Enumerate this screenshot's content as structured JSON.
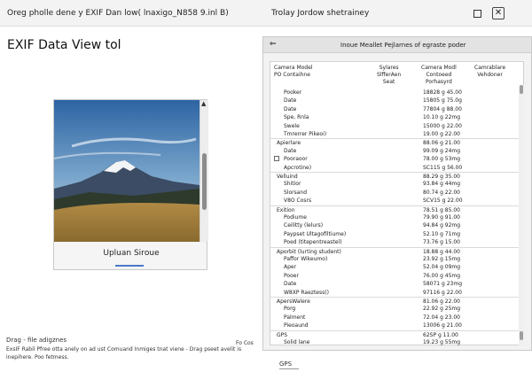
{
  "window": {
    "title": "Oreg pholle dene y EXIF Dan low( lnaxigo_N858 9.inl B)",
    "center_label": "Trolay Jordow shetrainey"
  },
  "app": {
    "title": "EXIF Data View tol"
  },
  "image_card": {
    "caption": "Upluan Sirоue"
  },
  "status": {
    "line1": "Drag - file adigznes",
    "line2": "ExsIF Rabil Pfree otta anely on ad ust Comuand Inmiges tnat viene - Drag pseet avelit is inepihere. Poo fetmess.",
    "right_label": "Fo Cos"
  },
  "panel": {
    "title": "Inoue Meallet Pejlarnes of egraste poder",
    "icon": "drag-handle-icon",
    "headers": [
      "Camera Model\nPO Contaihne",
      "Sylares\nSlfferAen\nSeat",
      "Camera Modl\nContoeed\nPorhasyrd",
      "Camrablare\nVehdoner"
    ],
    "rows": [
      {
        "label": "Pooker",
        "value": "18828 g 45.00"
      },
      {
        "label": "Date",
        "value": "15805 g 75.0g"
      },
      {
        "label": "Date",
        "value": "77804 g 88.00"
      },
      {
        "label": "Spe, Rnla",
        "value": "10.10 g 22mg"
      },
      {
        "label": "Swele",
        "value": "15000 g 22.00"
      },
      {
        "label": "Tmrerrer Pikeoi)",
        "value": "19.00 g 22.00"
      },
      {
        "label": "Apierlare",
        "value": "88.06 g 21.00",
        "section": true
      },
      {
        "label": "Date",
        "value": "99.09 g 24mg"
      },
      {
        "label": "Pooraoor",
        "value": "78.00 g 53mg",
        "check": true
      },
      {
        "label": "Apcrotine)",
        "value": "SC115 g 56.00"
      },
      {
        "label": "Velluind",
        "value": "88.29 g 35.00",
        "section": true
      },
      {
        "label": "Shitior",
        "value": "93.84 g 44mg"
      },
      {
        "label": "Slorsand",
        "value": "80.74 g 22.00"
      },
      {
        "label": "V8O Cosrs",
        "value": "SCV15 g 22.00"
      },
      {
        "label": "Exition",
        "value": "78.51 g 85.00",
        "section": true
      },
      {
        "label": "Podiume",
        "value": "79.90 g 91.00"
      },
      {
        "label": "Ceilitty (lelurs)",
        "value": "94.84 g 92mg"
      },
      {
        "label": "Paypset Ultagofiltiume)",
        "value": "52.10 g 71mg"
      },
      {
        "label": "Poed (titepentreastel)",
        "value": "73.76 g 15.00"
      },
      {
        "label": "Aporbit (lurting student)",
        "value": "18.88 g 44.00",
        "section": true
      },
      {
        "label": "Paffor Wikeumo)",
        "value": "23.92 g 15mg"
      },
      {
        "label": "Aper",
        "value": "52.04 g 09mg"
      },
      {
        "label": "Pooer",
        "value": "76.00 g 45mg"
      },
      {
        "label": "Date",
        "value": "58071 g 23mg"
      },
      {
        "label": "W8XP Raeztess()",
        "value": "97116 g 22.00"
      },
      {
        "label": "ApersWalere",
        "value": "81.06 g 22.00",
        "section": true
      },
      {
        "label": "Porg",
        "value": "22.92 g 25mg"
      },
      {
        "label": "Palment",
        "value": "72.04 g 23.00"
      },
      {
        "label": "Pieoaund",
        "value": "13006 g 21.00"
      },
      {
        "label": "GPS",
        "value": "62SP g 11.00",
        "section": true
      },
      {
        "label": "Solid lane",
        "value": "19.23 g 55mg"
      }
    ],
    "tab": "GPS"
  }
}
